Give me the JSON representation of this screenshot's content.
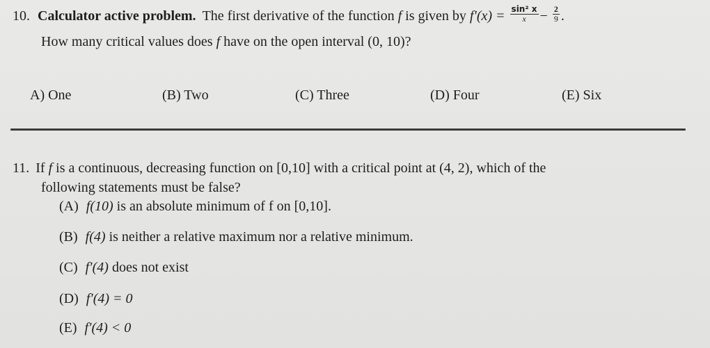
{
  "q10": {
    "number": "10.",
    "lead": "Calculator active problem.",
    "text_before": "The first derivative of the function",
    "f": "f",
    "text_mid": "is given by",
    "fprime": "f′(x) =",
    "frac1_num": "sin² x",
    "frac1_den": "x",
    "minus": "−",
    "frac2_num": "2",
    "frac2_den": "9",
    "period": ".",
    "line2_pre": "How many critical values does",
    "line2_f": "f",
    "line2_post": "have on the open interval (0, 10)?",
    "choices": [
      {
        "label": "A) One"
      },
      {
        "label": "(B) Two"
      },
      {
        "label": "(C) Three"
      },
      {
        "label": "(D) Four"
      },
      {
        "label": "(E) Six"
      }
    ]
  },
  "q11": {
    "number": "11.",
    "line1_pre": "If",
    "f": "f",
    "line1_post": "is a continuous, decreasing function on [0,10] with a critical point at (4, 2), which of the",
    "line2": "following statements must be false?",
    "choices": [
      {
        "letter": "(A)",
        "math": "f(10)",
        "text": "is an absolute minimum of f on [0,10]."
      },
      {
        "letter": "(B)",
        "math": "f(4)",
        "text": "is neither a relative maximum nor a relative minimum."
      },
      {
        "letter": "(C)",
        "math": "f′(4)",
        "text": "does not exist"
      },
      {
        "letter": "(D)",
        "math": "f′(4) = 0",
        "text": ""
      },
      {
        "letter": "(E)",
        "math": "f′(4) < 0",
        "text": ""
      }
    ]
  }
}
